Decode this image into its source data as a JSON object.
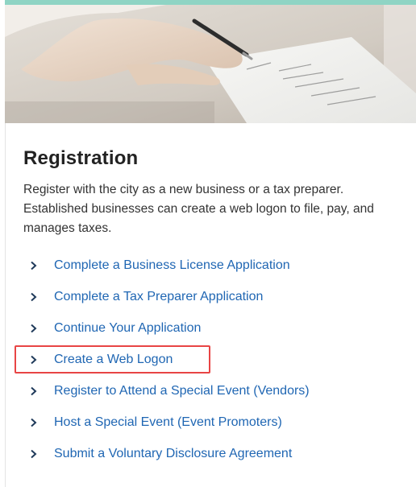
{
  "card": {
    "title": "Registration",
    "description": "Register with the city as a new business or a tax preparer. Established businesses can create a web logon to file, pay, and manages taxes.",
    "hero_image": "hand-signing-document-photo",
    "links": [
      {
        "label": "Complete a Business License Application",
        "icon": "chevron-right-icon",
        "highlighted": false
      },
      {
        "label": "Complete a Tax Preparer Application",
        "icon": "chevron-right-icon",
        "highlighted": false
      },
      {
        "label": "Continue Your Application",
        "icon": "chevron-right-icon",
        "highlighted": false
      },
      {
        "label": "Create a Web Logon",
        "icon": "chevron-right-icon",
        "highlighted": true
      },
      {
        "label": "Register to Attend a Special Event (Vendors)",
        "icon": "chevron-right-icon",
        "highlighted": false
      },
      {
        "label": "Host a Special Event (Event Promoters)",
        "icon": "chevron-right-icon",
        "highlighted": false
      },
      {
        "label": "Submit a Voluntary Disclosure Agreement",
        "icon": "chevron-right-icon",
        "highlighted": false
      }
    ]
  },
  "colors": {
    "accent": "#8fd4c4",
    "link": "#1f66b3",
    "highlight_border": "#e84545",
    "title": "#222222"
  }
}
